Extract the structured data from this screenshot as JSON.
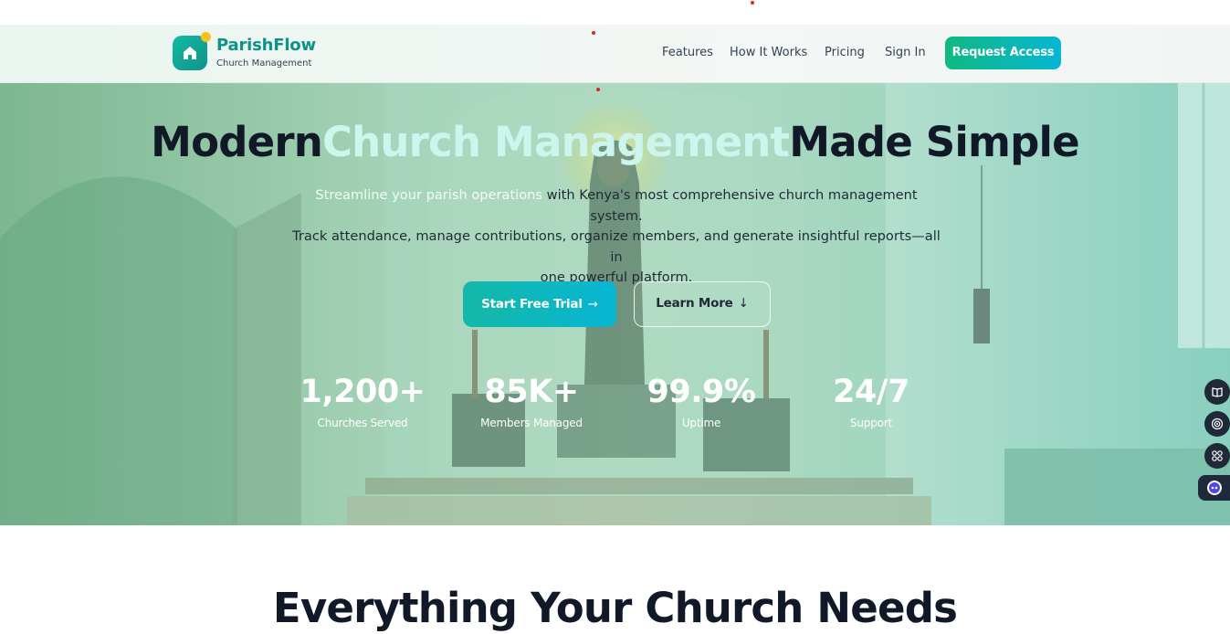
{
  "brand": {
    "name": "ParishFlow",
    "subtitle": "Church Management"
  },
  "nav": {
    "links": [
      "Features",
      "How It Works",
      "Pricing",
      "Sign In"
    ],
    "cta_label": "Request Access"
  },
  "hero": {
    "title_part1": "Modern",
    "title_accent": "Church Management",
    "title_part2": "Made Simple",
    "desc_highlight": "Streamline your parish operations",
    "desc_line1_rest": " with Kenya's most comprehensive church management system.",
    "desc_line2": "Track attendance, manage contributions, organize members, and generate insightful reports—all in",
    "desc_line3": "one powerful platform.",
    "primary_button": "Start Free Trial",
    "secondary_button": "Learn More",
    "stats": [
      {
        "value": "1,200+",
        "label": "Churches Served"
      },
      {
        "value": "85K+",
        "label": "Members Managed"
      },
      {
        "value": "99.9%",
        "label": "Uptime"
      },
      {
        "value": "24/7",
        "label": "Support"
      }
    ]
  },
  "side_widgets": [
    "book-icon",
    "broadcast-icon",
    "apps-icon",
    "assistant-icon"
  ],
  "next_section": {
    "title": "Everything Your Church Needs"
  },
  "colors": {
    "accent": "#14b8a6",
    "accent_secondary": "#06b6d4",
    "brand_text": "#0d9488",
    "dark_text": "#111827"
  }
}
